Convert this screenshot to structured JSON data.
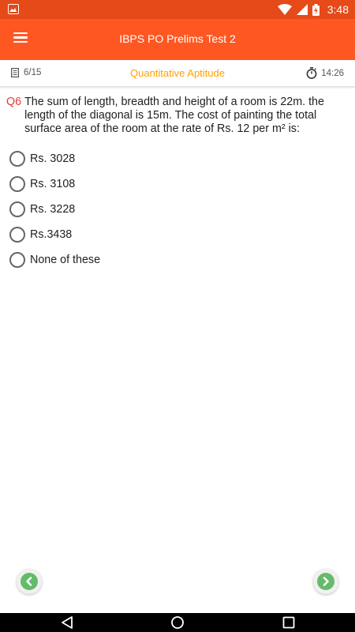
{
  "status_bar": {
    "time": "3:48",
    "icons": [
      "gallery-notification-icon",
      "wifi-icon",
      "signal-icon",
      "battery-charging-icon"
    ]
  },
  "app_bar": {
    "title": "IBPS PO Prelims Test 2",
    "menu_icon": "hamburger-menu-icon"
  },
  "info_bar": {
    "question_counter": "6/15",
    "section": "Quantitative Aptitude",
    "timer": "14:26"
  },
  "question": {
    "number": "Q6",
    "text": "The sum of length, breadth and height of a room is 22m. the length of the diagonal is 15m. The cost of painting the total surface area of the room at the rate of Rs. 12 per m² is:"
  },
  "options": [
    {
      "label": "Rs. 3028"
    },
    {
      "label": "Rs. 3108"
    },
    {
      "label": "Rs. 3228"
    },
    {
      "label": "Rs.3438"
    },
    {
      "label": "None of these"
    }
  ],
  "colors": {
    "status_bar": "#e64a19",
    "app_bar": "#ff5722",
    "section_title": "#ffa000",
    "question_number": "#e53935",
    "nav_button": "#66bb6a"
  },
  "navigation": {
    "prev_icon": "chevron-left-icon",
    "next_icon": "chevron-right-icon"
  }
}
